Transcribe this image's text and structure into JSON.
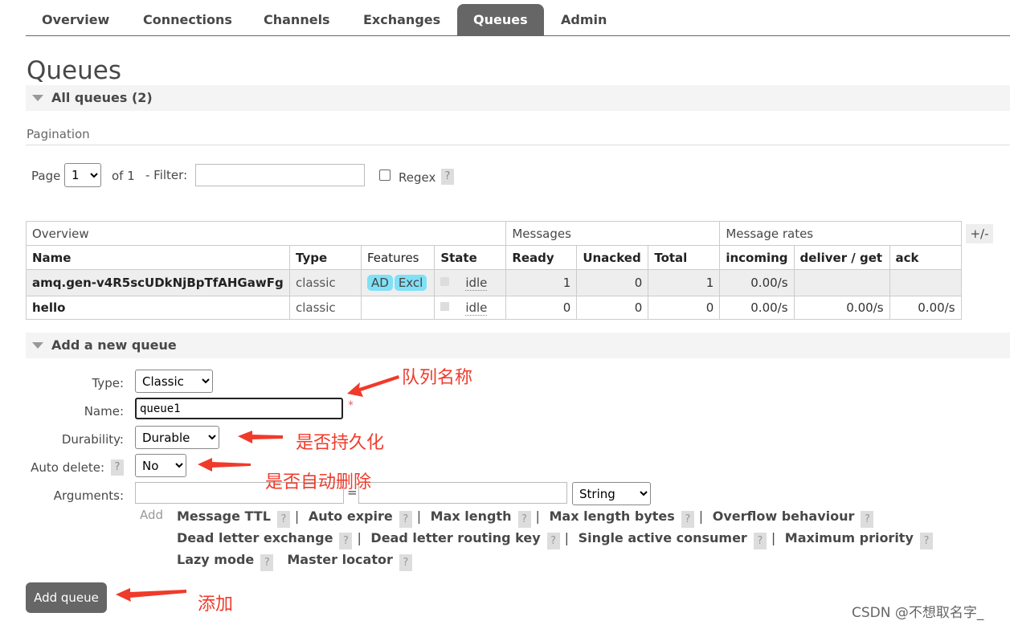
{
  "nav": {
    "tabs": [
      {
        "label": "Overview"
      },
      {
        "label": "Connections"
      },
      {
        "label": "Channels"
      },
      {
        "label": "Exchanges"
      },
      {
        "label": "Queues"
      },
      {
        "label": "Admin"
      }
    ],
    "active": "Queues"
  },
  "page_title": "Queues",
  "all_queues": {
    "label": "All queues (2)"
  },
  "pagination": {
    "label": "Pagination",
    "page_label": "Page",
    "page_value": "1",
    "of_label": "of 1",
    "filter_label": "- Filter:",
    "filter_value": "",
    "regex_label": "Regex",
    "help": "?"
  },
  "table": {
    "groups": [
      "Overview",
      "Messages",
      "Message rates"
    ],
    "columns": [
      "Name",
      "Type",
      "Features",
      "State",
      "Ready",
      "Unacked",
      "Total",
      "incoming",
      "deliver / get",
      "ack"
    ],
    "toggle": "+/-",
    "rows": [
      {
        "name": "amq.gen-v4R5scUDkNjBpTfAHGawFg",
        "type": "classic",
        "features": [
          "AD",
          "Excl"
        ],
        "state": "idle",
        "ready": "1",
        "unacked": "0",
        "total": "1",
        "incoming": "0.00/s",
        "deliver_get": "",
        "ack": ""
      },
      {
        "name": "hello",
        "type": "classic",
        "features": [],
        "state": "idle",
        "ready": "0",
        "unacked": "0",
        "total": "0",
        "incoming": "0.00/s",
        "deliver_get": "0.00/s",
        "ack": "0.00/s"
      }
    ]
  },
  "add_queue": {
    "section_label": "Add a new queue",
    "type_label": "Type:",
    "type_value": "Classic",
    "name_label": "Name:",
    "name_value": "queue1",
    "required_mark": "*",
    "durability_label": "Durability:",
    "durability_value": "Durable",
    "auto_delete_label": "Auto delete:",
    "auto_delete_value": "No",
    "arguments_label": "Arguments:",
    "arg_key": "",
    "arg_eq": "=",
    "arg_value": "",
    "arg_type": "String",
    "add_link": "Add",
    "arg_links": [
      "Message TTL",
      "Auto expire",
      "Max length",
      "Max length bytes",
      "Overflow behaviour",
      "Dead letter exchange",
      "Dead letter routing key",
      "Single active consumer",
      "Maximum priority",
      "Lazy mode",
      "Master locator"
    ],
    "submit_label": "Add queue"
  },
  "annotations": {
    "queue_name": "队列名称",
    "durable": "是否持久化",
    "auto_delete": "是否自动删除",
    "add": "添加"
  },
  "watermark": "CSDN @不想取名字_",
  "colors": {
    "tab_active": "#666666",
    "feature_badge": "#80e0f6",
    "annotation": "#f03a2a"
  }
}
